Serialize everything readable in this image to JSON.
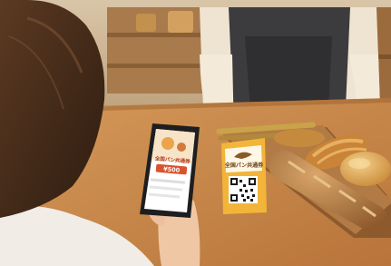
{
  "scene": {
    "phone_screen": {
      "title": "全国パン共通券",
      "amount": "¥500"
    },
    "stand_sign": {
      "title": "全国パン共通券"
    }
  }
}
